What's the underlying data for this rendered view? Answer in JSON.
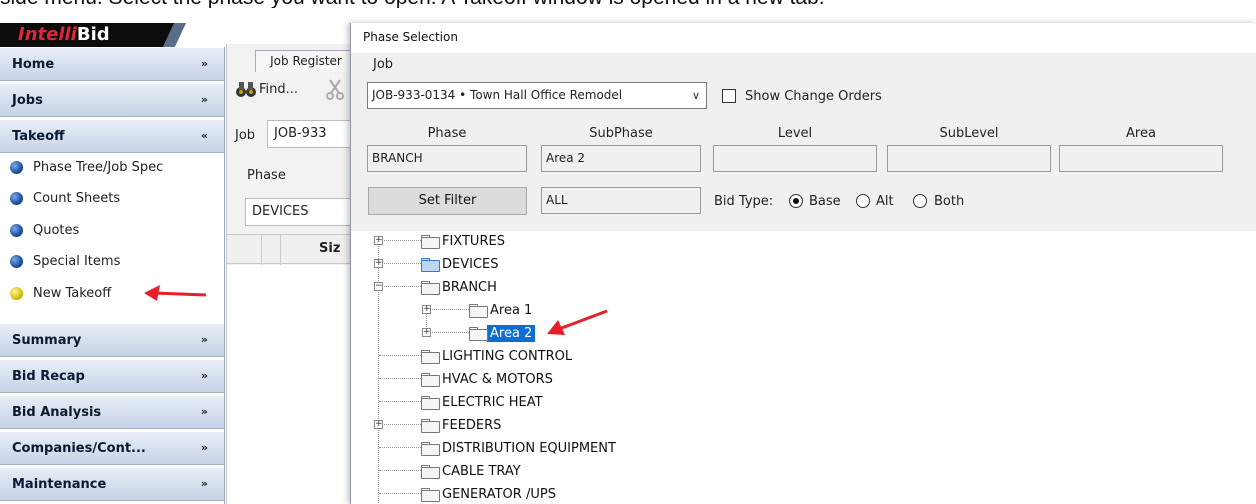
{
  "caption": "side menu. Select the phase you want to open. A Takeoff window is opened in a new tab.",
  "logo": {
    "part1": "Intelli",
    "part2": "Bid"
  },
  "sidebar": {
    "sections_top": [
      {
        "label": "Home",
        "chevron": "»"
      },
      {
        "label": "Jobs",
        "chevron": "»"
      },
      {
        "label": "Takeoff",
        "chevron": "«"
      }
    ],
    "takeoff_items": [
      {
        "label": "Phase Tree/Job Spec",
        "dot": "blue"
      },
      {
        "label": "Count Sheets",
        "dot": "blue"
      },
      {
        "label": "Quotes",
        "dot": "blue"
      },
      {
        "label": "Special Items",
        "dot": "blue"
      },
      {
        "label": "New Takeoff",
        "dot": "yellow"
      }
    ],
    "sections_bottom": [
      {
        "label": "Summary",
        "chevron": "»"
      },
      {
        "label": "Bid Recap",
        "chevron": "»"
      },
      {
        "label": "Bid Analysis",
        "chevron": "»"
      },
      {
        "label": "Companies/Cont...",
        "chevron": "»"
      },
      {
        "label": "Maintenance",
        "chevron": "»"
      }
    ]
  },
  "job_register": {
    "tab": "Job Register",
    "find": "Find...",
    "job_label": "Job",
    "job_value": "JOB-933",
    "phase_label": "Phase",
    "phase_value": "DEVICES",
    "grid_col": "Siz"
  },
  "dialog": {
    "title": "Phase Selection",
    "job_label": "Job",
    "job_value": "JOB-933-0134 • Town Hall Office Remodel",
    "show_change_orders": "Show Change Orders",
    "columns": [
      "Phase",
      "SubPhase",
      "Level",
      "SubLevel",
      "Area"
    ],
    "values": [
      "BRANCH",
      "Area 2",
      "",
      "",
      ""
    ],
    "set_filter": "Set Filter",
    "filter_value": "ALL",
    "bid_type_label": "Bid Type:",
    "bid_types": [
      {
        "label": "Base",
        "selected": true
      },
      {
        "label": "Alt",
        "selected": false
      },
      {
        "label": "Both",
        "selected": false
      }
    ],
    "tree": [
      {
        "label": "FIXTURES",
        "level": 0,
        "expander": "+",
        "blue": false
      },
      {
        "label": "DEVICES",
        "level": 0,
        "expander": "+",
        "blue": true
      },
      {
        "label": "BRANCH",
        "level": 0,
        "expander": "-",
        "blue": false
      },
      {
        "label": "Area 1",
        "level": 1,
        "expander": "+",
        "blue": false
      },
      {
        "label": "Area 2",
        "level": 1,
        "expander": "+",
        "blue": false,
        "selected": true
      },
      {
        "label": "LIGHTING CONTROL",
        "level": 0,
        "expander": "",
        "blue": false
      },
      {
        "label": "HVAC & MOTORS",
        "level": 0,
        "expander": "",
        "blue": false
      },
      {
        "label": "ELECTRIC HEAT",
        "level": 0,
        "expander": "",
        "blue": false
      },
      {
        "label": "FEEDERS",
        "level": 0,
        "expander": "+",
        "blue": false
      },
      {
        "label": "DISTRIBUTION EQUIPMENT",
        "level": 0,
        "expander": "",
        "blue": false
      },
      {
        "label": "CABLE TRAY",
        "level": 0,
        "expander": "",
        "blue": false
      },
      {
        "label": "GENERATOR /UPS",
        "level": 0,
        "expander": "",
        "blue": false
      }
    ]
  },
  "colors": {
    "arrow": "#e5202a",
    "selection": "#0a6fd1"
  }
}
